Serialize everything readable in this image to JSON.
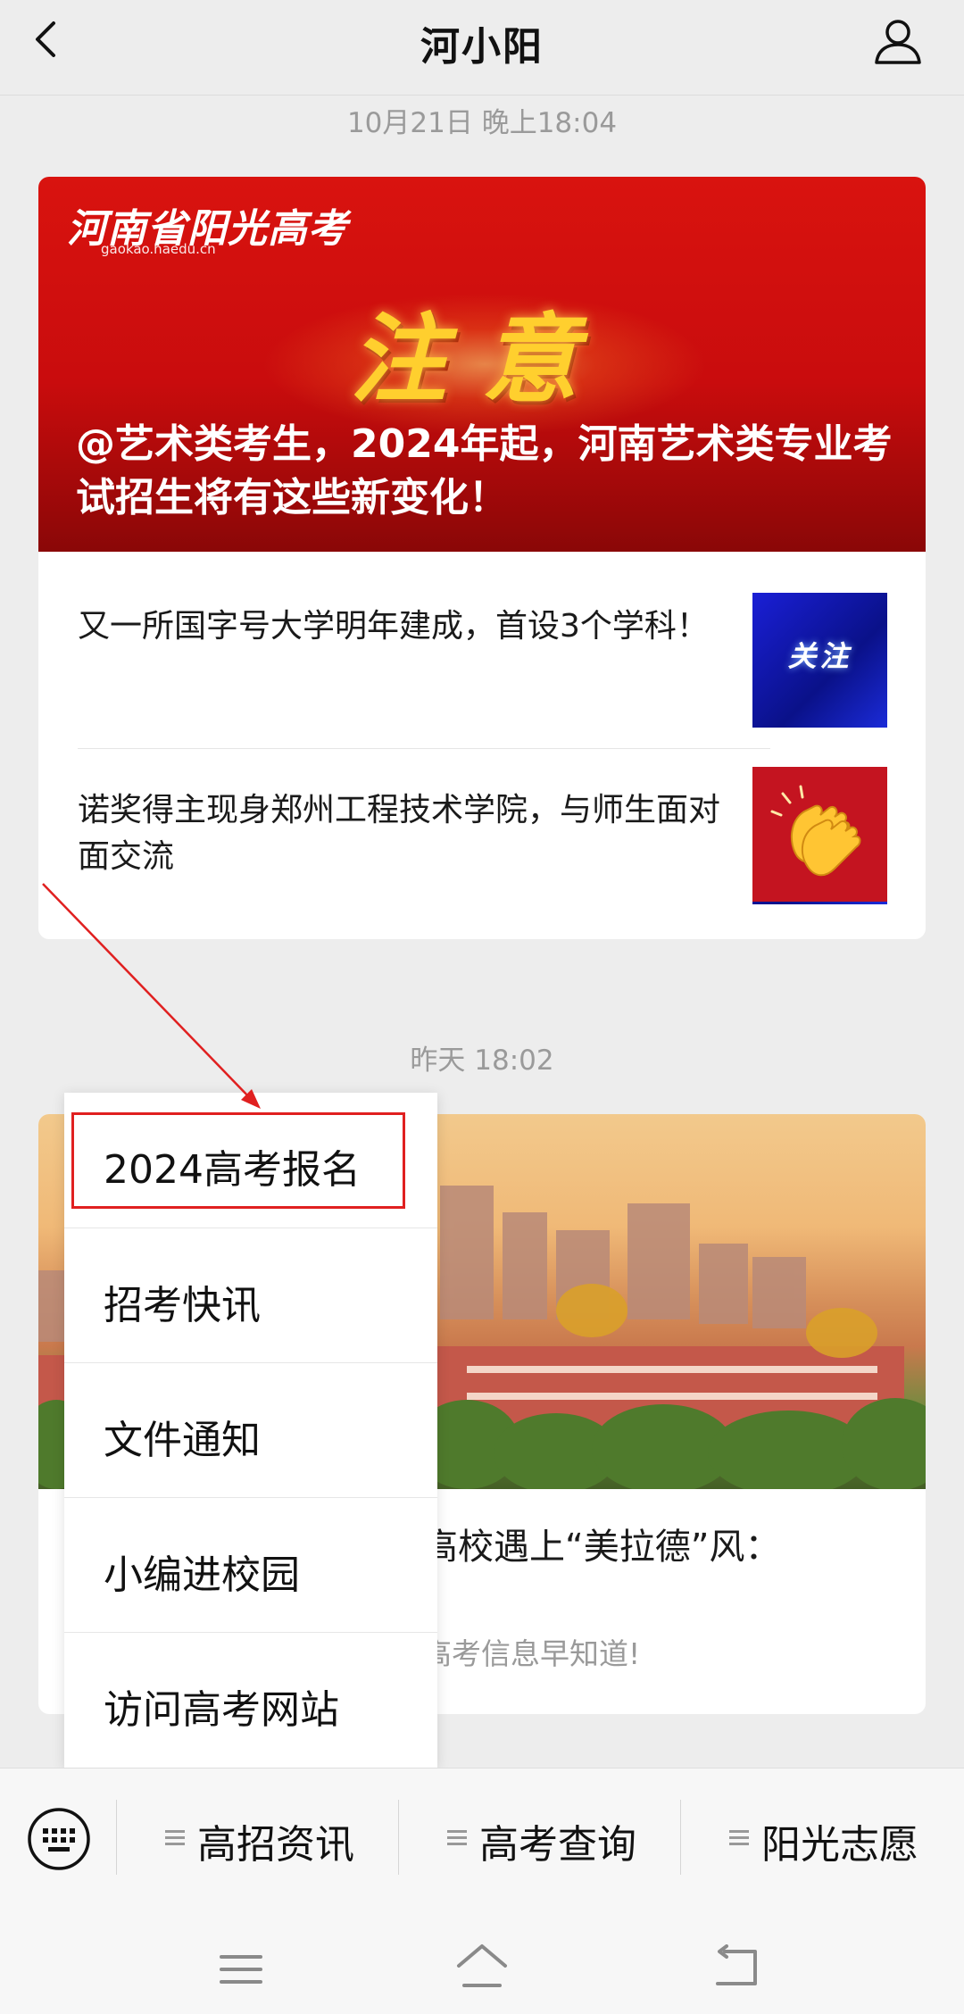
{
  "header": {
    "title": "河小阳"
  },
  "timestamps": {
    "first": "10月21日 晚上18:04",
    "second": "昨天 18:02"
  },
  "article_card_1": {
    "banner": {
      "logo_text": "河南省阳光高考",
      "logo_url": "gaokao.haedu.cn",
      "headline": "注意",
      "title": "@艺术类考生，2024年起，河南艺术类专业考试招生将有这些新变化！"
    },
    "items": [
      {
        "title": "又一所国字号大学明年建成，首设3个学科！",
        "thumb_text": "关注"
      },
      {
        "title": "诺奖得主现身郑州工程技术学院，与师生面对面交流",
        "thumb_icon": "clapping-hands-icon"
      }
    ]
  },
  "article_card_2": {
    "title_partial": "高校遇上“美拉德”风：",
    "subtitle_partial": "高考信息早知道!"
  },
  "popup_menu": {
    "items": [
      "2024高考报名",
      "招考快讯",
      "文件通知",
      "小编进校园",
      "访问高考网站"
    ],
    "highlighted_index": 0
  },
  "bottom_menu": {
    "tabs": [
      "高招资讯",
      "高考查询",
      "阳光志愿"
    ]
  },
  "colors": {
    "accent_red": "#e02020",
    "banner_red": "#d9130f",
    "background": "#ededed"
  }
}
